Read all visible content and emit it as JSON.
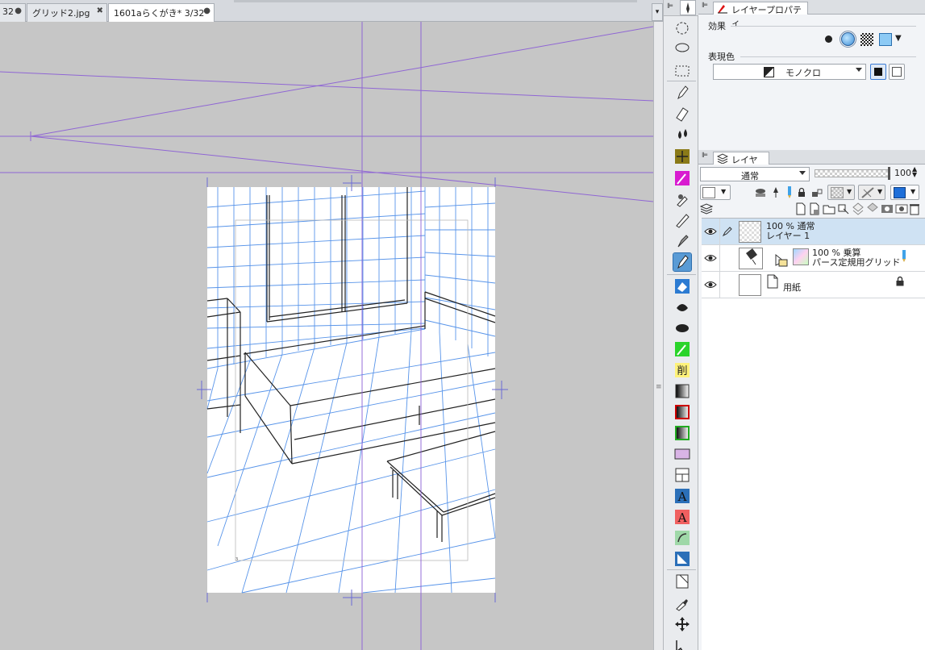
{
  "tabs": [
    {
      "label": "32",
      "dirty_mark": "●"
    },
    {
      "label": "グリッド2.jpg",
      "close": "✖"
    },
    {
      "label": "1601aらくがき* 3/32",
      "dirty_mark": "●"
    }
  ],
  "canvas": {
    "page_number": "3"
  },
  "layer_property": {
    "tab_label": "レイヤープロパティ",
    "effect_label": "効果",
    "expression_color_label": "表現色",
    "expression_color_value": "モノクロ"
  },
  "layers_panel": {
    "tab_label": "レイヤー",
    "blend_mode": "通常",
    "opacity": "100",
    "layers": [
      {
        "opacity_mode": "100 % 通常",
        "name": "レイヤー 1"
      },
      {
        "opacity_mode": "100 % 乗算",
        "name": "パース定規用グリッド"
      },
      {
        "opacity_mode": "",
        "name": "用紙"
      }
    ]
  },
  "colors": {
    "accent": "#5a9bd5",
    "guide": "#8a5cd6",
    "grid": "#3b82e6",
    "selected_row": "#cfe2f3"
  },
  "icons": {
    "toolbar": [
      "rotate-icon",
      "lasso-icon",
      "marquee-icon",
      "pen-icon",
      "eraser-icon",
      "ink-drops-icon",
      "move-layer-icon",
      "magic-wand-icon",
      "eyedropper-icon",
      "pencil-icon",
      "marker-icon",
      "ruler-pen-icon",
      "fill-bucket-icon",
      "ink-splash-icon",
      "blob-icon",
      "color-wand-icon",
      "delete-icon",
      "gradient-icon",
      "gradient-red-icon",
      "gradient-green-icon",
      "frame-icon",
      "panel-icon",
      "text-icon",
      "text-red-icon",
      "balloon-icon",
      "ruler-icon",
      "operation-icon",
      "eyedropper-small-icon",
      "move-icon",
      "object-icon"
    ]
  }
}
